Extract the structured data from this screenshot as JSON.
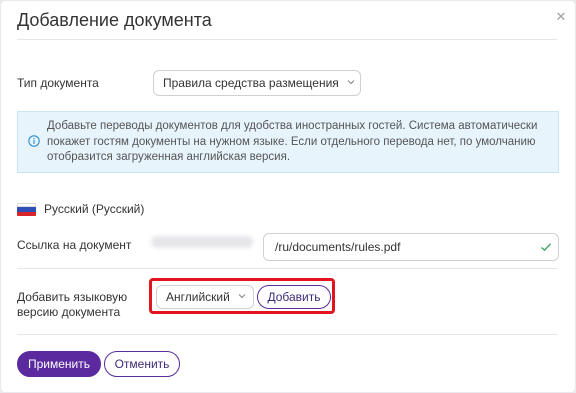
{
  "dialog": {
    "title": "Добавление документа",
    "close_icon": "close-icon"
  },
  "document_type": {
    "label": "Тип документа",
    "selected": "Правила средства размещения"
  },
  "info": {
    "text": "Добавьте переводы документов для удобства иностранных гостей. Система автоматически покажет гостям документы на нужном языке. Если отдельного перевода нет, по умолчанию отобразится загруженная английская версия.",
    "icon": "info-icon"
  },
  "language": {
    "name": "Русский (Русский)",
    "flag": "russia-flag-icon"
  },
  "document_link": {
    "label": "Ссылка на документ",
    "value": "/ru/documents/rules.pdf",
    "valid_icon": "checkmark-icon"
  },
  "add_language": {
    "label_line1": "Добавить языковую",
    "label_line2": "версию документа",
    "selected_language": "Английский",
    "add_button": "Добавить"
  },
  "footer": {
    "apply_button": "Применить",
    "cancel_button": "Отменить"
  },
  "colors": {
    "accent": "#5b2a9e",
    "info_bg": "#e7f4fb",
    "highlight": "#e2141f",
    "valid": "#3aa55d"
  }
}
